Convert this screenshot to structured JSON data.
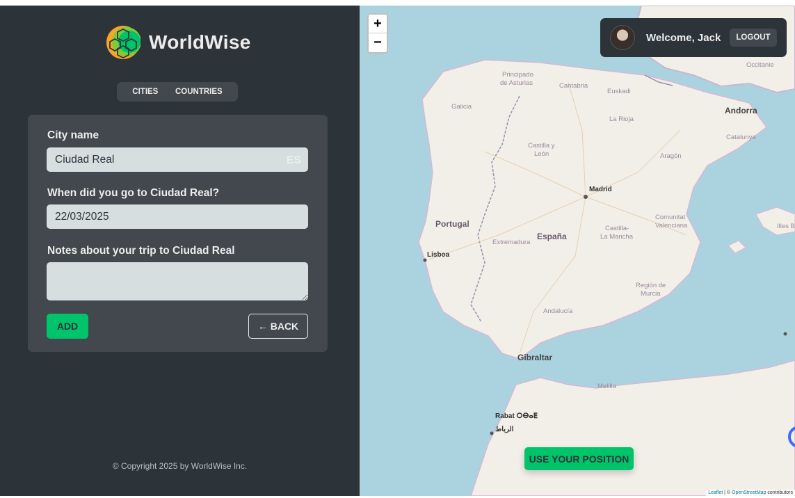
{
  "app": {
    "name": "WorldWise"
  },
  "nav": {
    "tabs": [
      {
        "label": "Cities"
      },
      {
        "label": "Countries"
      }
    ]
  },
  "form": {
    "city_label": "City name",
    "city_value": "Ciudad Real",
    "flag": "ES",
    "date_label": "When did you go to Ciudad Real?",
    "date_value": "22/03/2025",
    "notes_label": "Notes about your trip to Ciudad Real",
    "notes_value": "",
    "add_label": "ADD",
    "back_label": "← BACK"
  },
  "footer": {
    "text": "© Copyright 2025 by WorldWise Inc."
  },
  "map": {
    "zoom_in": "+",
    "zoom_out": "−",
    "labels": {
      "portugal": "Portugal",
      "espana": "España",
      "andorra": "Andorra",
      "gibraltar": "Gibraltar",
      "madrid": "Madrid",
      "lisboa": "Lisboa",
      "rabat": "Rabat ⵔⴱⴰⵟ",
      "rabat_ar": "الرباط",
      "principado": "Principado",
      "asturias": "de Asturias",
      "cantabria": "Cantabria",
      "euskadi": "Euskadi",
      "galicia": "Galicia",
      "larioja": "La Rioja",
      "catalunya": "Catalunya",
      "occitanie": "Occitanie",
      "castillay": "Castilla y",
      "leon": "León",
      "aragon": "Aragón",
      "extremadura": "Extremadura",
      "castilla": "Castilla-",
      "lamancha": "La Mancha",
      "comunitat": "Comunitat",
      "valenciana": "Valenciana",
      "andalucia": "Andalucía",
      "regionde": "Región de",
      "murcia": "Murcia",
      "melilla": "Melilla",
      "illes": "Illes Ba"
    },
    "attribution": {
      "leaflet": "Leaflet",
      "sep": " | © ",
      "osm": "OpenStreetMap",
      "contributors": " contributors"
    },
    "use_position_label": "USE YOUR POSITION"
  },
  "user": {
    "welcome": "Welcome, Jack",
    "logout_label": "LOGOUT"
  },
  "colors": {
    "brand": "#00c46a",
    "dark": "#2d3439",
    "medium": "#42484d",
    "light": "#d6dee0",
    "sea": "#aad3df",
    "land": "#f2efe9"
  }
}
